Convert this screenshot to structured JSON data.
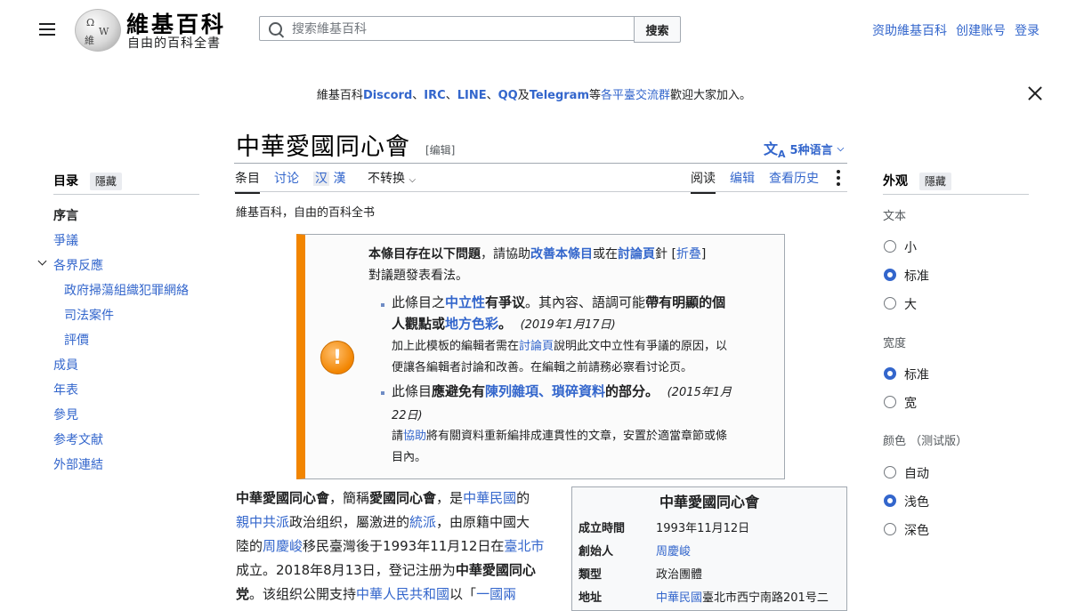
{
  "header": {
    "logo_title": "維基百科",
    "logo_subtitle": "自由的百科全書",
    "globe_glyphs": [
      "Ω",
      "W",
      "維"
    ],
    "search_placeholder": "搜索維基百科",
    "search_button": "搜索",
    "user_links": [
      "资助維基百科",
      "创建账号",
      "登录"
    ]
  },
  "sitenotice": {
    "prefix": "維基百科",
    "discord": "Discord",
    "sep1": "、",
    "irc": "IRC",
    "sep2": "、",
    "line": "LINE",
    "sep3": "、",
    "qq": "QQ",
    "and": "及",
    "telegram": "Telegram",
    "deng": "等",
    "platforms": "各平臺交流群",
    "suffix": "歡迎大家加入。"
  },
  "page": {
    "title": "中華愛國同心會",
    "edit_link": "[编辑]",
    "languages": "5种语言",
    "tagline": "維基百科，自由的百科全书"
  },
  "tabs": {
    "article": "条目",
    "talk": "讨论",
    "variant_hans": "汉",
    "variant_hant": "漢",
    "no_convert": "不转换",
    "read": "阅读",
    "edit": "编辑",
    "history": "查看历史"
  },
  "toc": {
    "heading": "目录",
    "hide": "隱藏",
    "items": [
      "序言",
      "爭議",
      "各界反應",
      "政府掃蕩組織犯罪網絡",
      "司法案件",
      "評價",
      "成員",
      "年表",
      "參見",
      "参考文献",
      "外部連結"
    ]
  },
  "appearance": {
    "heading": "外观",
    "hide": "隱藏",
    "text_label": "文本",
    "text_options": [
      "小",
      "标准",
      "大"
    ],
    "text_selected": "标准",
    "width_label": "宽度",
    "width_options": [
      "标准",
      "宽"
    ],
    "width_selected": "标准",
    "color_label": "颜色 （测试版）",
    "color_options": [
      "自动",
      "浅色",
      "深色"
    ],
    "color_selected": "浅色"
  },
  "ambox": {
    "icon": "!",
    "line1_b": "本條目存在以下問題",
    "line1_t1": "，請協助",
    "line1_l1": "改善本條目",
    "line1_t2": "或在",
    "line1_l2": "討論頁",
    "line1_t3": "針 [",
    "line1_l3": "折叠",
    "line1_t4": "]",
    "line2": "對議題發表看法。",
    "b1_t1": "此條目之",
    "b1_l1": "中立性",
    "b1_b1": "有爭议",
    "b1_t2": "。其內容、語調可能",
    "b1_b2": "帶有明顯的個",
    "b1_b3": "人觀點或",
    "b1_l2": "地方色彩",
    "b1_t3": "。",
    "b1_date": "(2019年1月17日)",
    "b1_s1a": "加上此模板的編輯者需在",
    "b1_s1l": "討論頁",
    "b1_s1b": "說明此文中立性有爭議的原因，以",
    "b1_s2": "便讓各編輯者討論和改善。在編輯之前請務必察看讨论页。",
    "b2_t1": "此條目",
    "b2_b1": "應避免有",
    "b2_l1": "陳列雜項、瑣碎資料",
    "b2_b2": "的部分。",
    "b2_date1": "(2015年1月",
    "b2_date2": "22日)",
    "b2_s1a": "請",
    "b2_s1l": "協助",
    "b2_s1b": "將有關資料重新編排成連貫性的文章，安置於適當章節或條",
    "b2_s2": "目內。"
  },
  "lead": {
    "l1": [
      "中華愛國同心會",
      "，簡稱",
      "愛國同心會",
      "，是",
      "中華民國",
      "的"
    ],
    "l2": [
      "親中共派",
      "政治组织，屬激进的",
      "統派",
      "，由原籍中國大"
    ],
    "l3": [
      "陸的",
      "周慶峻",
      "移民臺灣後于1993年11月12日在",
      "臺北市"
    ],
    "l4": [
      "成立。2018年8月13日，登记注册为",
      "中華愛國同心"
    ],
    "l5": [
      "党",
      "。该组织公開支持",
      "中華人民共和國",
      "以「",
      "一國兩"
    ]
  },
  "infobox": {
    "title": "中華愛國同心會",
    "rows": [
      {
        "key": "成立時間",
        "value": "1993年11月12日"
      },
      {
        "key": "創始人",
        "value": "周慶峻"
      },
      {
        "key": "類型",
        "value": "政治團體"
      },
      {
        "key": "地址",
        "value": "中華民國臺北市西宁南路201号二"
      }
    ],
    "addr_link": "中華民國",
    "addr_rest": "臺北市西宁南路201号二"
  }
}
